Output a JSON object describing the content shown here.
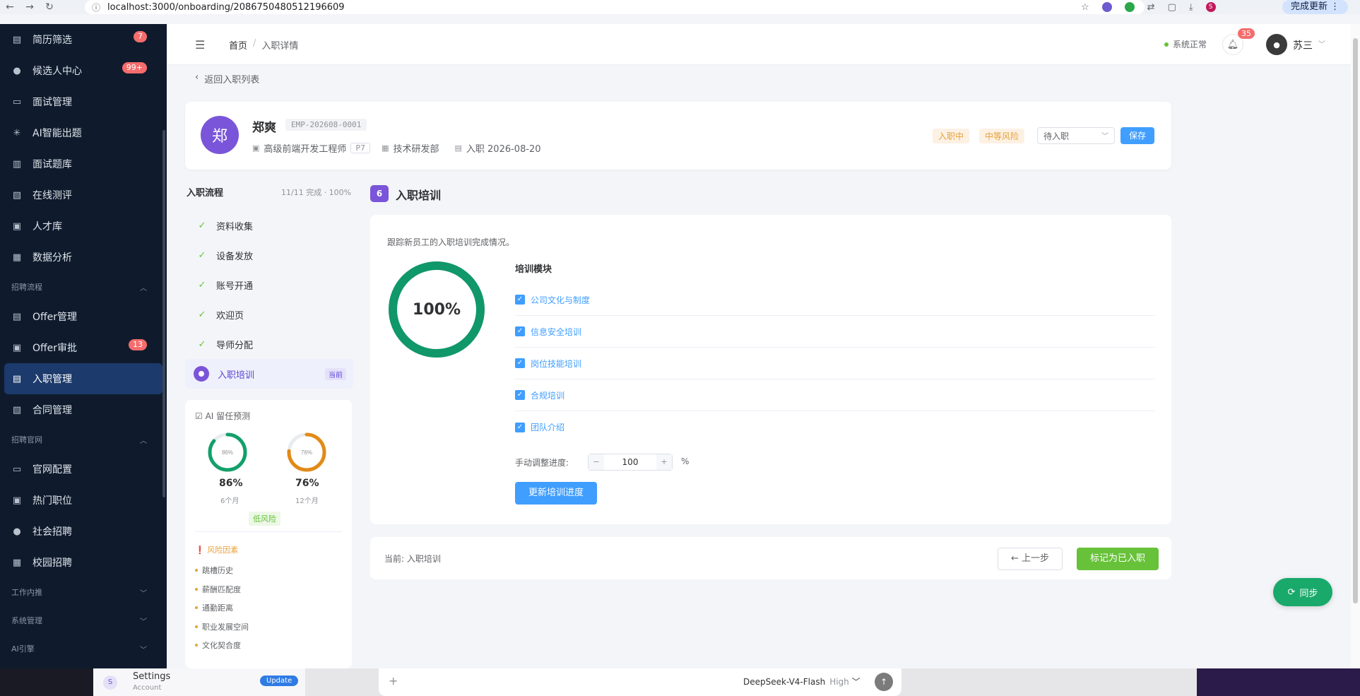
{
  "browser": {
    "url": "localhost:3000/onboarding/2086750480512196609",
    "finish_update": "完成更新",
    "profile_letter": "S"
  },
  "sidebar": {
    "items": [
      {
        "label": "简历筛选",
        "icon": "document-icon",
        "badge": "7"
      },
      {
        "label": "候选人中心",
        "icon": "user-icon",
        "badge": "99+"
      },
      {
        "label": "面试管理",
        "icon": "video-icon",
        "badge": ""
      },
      {
        "label": "AI智能出题",
        "icon": "sparkle-icon",
        "badge": ""
      },
      {
        "label": "面试题库",
        "icon": "book-icon",
        "badge": ""
      },
      {
        "label": "在线测评",
        "icon": "test-icon",
        "badge": ""
      },
      {
        "label": "人才库",
        "icon": "archive-icon",
        "badge": ""
      },
      {
        "label": "数据分析",
        "icon": "chart-icon",
        "badge": ""
      }
    ],
    "group_recruit": "招聘流程",
    "recruit_items": [
      {
        "label": "Offer管理",
        "icon": "offer-icon",
        "badge": ""
      },
      {
        "label": "Offer审批",
        "icon": "approval-icon",
        "badge": "13"
      },
      {
        "label": "入职管理",
        "icon": "onboarding-icon",
        "badge": "",
        "active": true
      },
      {
        "label": "合同管理",
        "icon": "contract-icon",
        "badge": ""
      }
    ],
    "group_site": "招聘官网",
    "site_items": [
      {
        "label": "官网配置",
        "icon": "monitor-icon"
      },
      {
        "label": "热门职位",
        "icon": "briefcase-icon"
      },
      {
        "label": "社会招聘",
        "icon": "user-icon"
      },
      {
        "label": "校园招聘",
        "icon": "building-icon"
      }
    ],
    "group_referral": "工作内推",
    "group_system": "系统管理",
    "group_ai": "AI引擎"
  },
  "header": {
    "breadcrumb_home": "首页",
    "breadcrumb_current": "入职详情",
    "system_status": "系统正常",
    "notification_count": "35",
    "user_name": "苏三"
  },
  "back_link": "返回入职列表",
  "employee": {
    "avatar_char": "郑",
    "name": "郑爽",
    "code": "EMP-202608-0001",
    "position": "高级前端开发工程师",
    "level": "P7",
    "department": "技术研发部",
    "join_date": "入职 2026-08-20",
    "tag_status": "入职中",
    "tag_risk": "中等风险",
    "status_select": "待入职",
    "save_label": "保存"
  },
  "flow": {
    "title": "入职流程",
    "progress": "11/11 完成 · 100%",
    "steps": [
      "资料收集",
      "设备发放",
      "账号开通",
      "欢迎页",
      "导师分配"
    ],
    "current_step": "入职培训",
    "current_tag": "当前"
  },
  "ai_prediction": {
    "title": "AI 留任预测",
    "six_month": {
      "value": 86,
      "display": "86%",
      "ring_label": "86%",
      "period": "6个月",
      "color": "#12a06a"
    },
    "twelve_month": {
      "value": 76,
      "display": "76%",
      "ring_label": "76%",
      "period": "12个月",
      "color": "#e28a17"
    },
    "risk_level": "低风险",
    "risk_title": "风险因素",
    "risk_factors": [
      "跳槽历史",
      "薪酬匹配度",
      "通勤距离",
      "职业发展空间",
      "文化契合度"
    ]
  },
  "training": {
    "section_number": "6",
    "section_title": "入职培训",
    "description": "跟踪新员工的入职培训完成情况。",
    "progress_display": "100%",
    "progress_value": 100,
    "ring_color": "#10976a",
    "modules_title": "培训模块",
    "modules": [
      "公司文化与制度",
      "信息安全培训",
      "岗位技能培训",
      "合规培训",
      "团队介绍"
    ],
    "adjust_label": "手动调整进度:",
    "adjust_value": "100",
    "adjust_unit": "%",
    "update_button": "更新培训进度"
  },
  "footer": {
    "current_prefix": "当前:",
    "current_step": "入职培训",
    "prev_button": "← 上一步",
    "done_button": "标记为已入职"
  },
  "sync_button": "同步",
  "taskbar": {
    "settings_title": "Settings",
    "settings_subtitle": "Account",
    "update_label": "Update",
    "model_name": "DeepSeek-V4-Flash",
    "model_level": "High"
  }
}
